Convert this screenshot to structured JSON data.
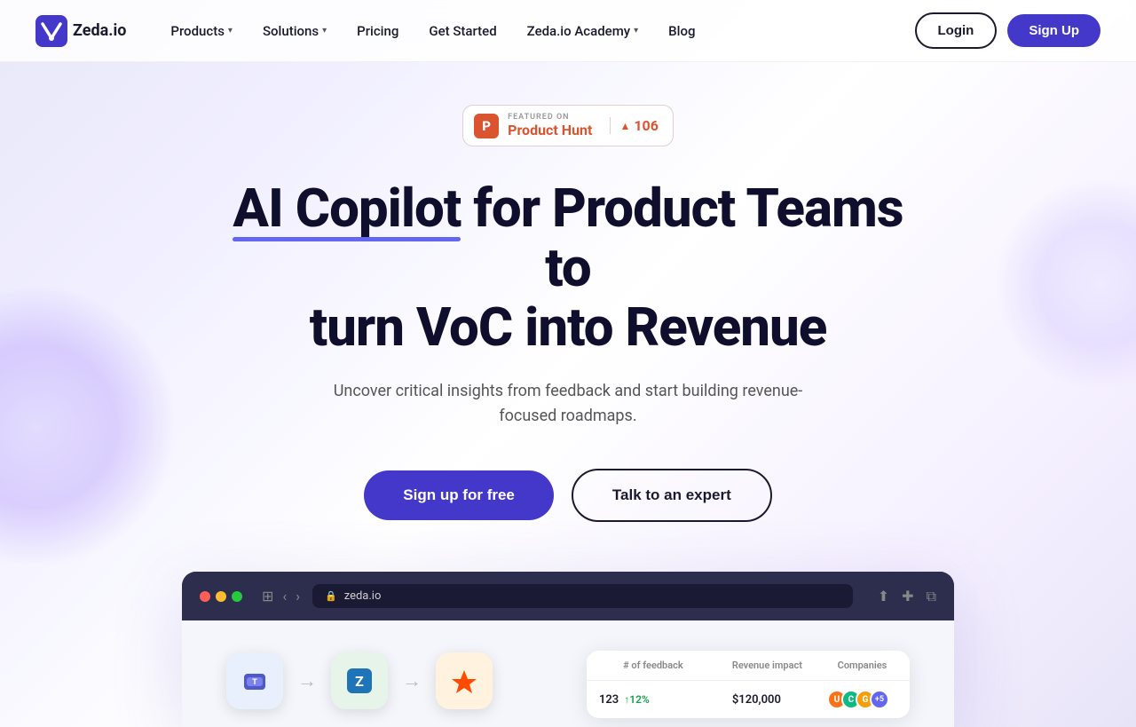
{
  "brand": {
    "name": "Zeda.io",
    "logo_text": "Zeda.io"
  },
  "nav": {
    "items": [
      {
        "label": "Products",
        "has_dropdown": true
      },
      {
        "label": "Solutions",
        "has_dropdown": true
      },
      {
        "label": "Pricing",
        "has_dropdown": false
      },
      {
        "label": "Get Started",
        "has_dropdown": false
      },
      {
        "label": "Zeda.io Academy",
        "has_dropdown": true
      },
      {
        "label": "Blog",
        "has_dropdown": false
      }
    ],
    "login_label": "Login",
    "signup_label": "Sign Up"
  },
  "product_hunt": {
    "featured_label": "FEATURED ON",
    "name": "Product Hunt",
    "score": "106"
  },
  "hero": {
    "title_line1": "AI Copilot for Product Teams to",
    "title_line2": "turn VoC into Revenue",
    "underline_word": "AI Copilot",
    "subtitle": "Uncover critical insights from feedback and start building revenue-focused roadmaps.",
    "cta_primary": "Sign up for free",
    "cta_secondary": "Talk to an expert"
  },
  "browser": {
    "address": "zeda.io"
  },
  "data_card": {
    "columns": [
      "# of feedback",
      "Revenue impact",
      "Companies"
    ],
    "rows": [
      {
        "feedback": "123",
        "feedback_change": "↑12%",
        "revenue": "$120,000",
        "companies_label": "+5"
      }
    ]
  },
  "integrations": [
    {
      "name": "microsoft-teams",
      "emoji": "🟦",
      "bg": "#e8f0fe"
    },
    {
      "name": "zendesk",
      "emoji": "🟩",
      "bg": "#e6f4ea"
    },
    {
      "name": "zapier",
      "emoji": "⚡",
      "bg": "#fff3e0"
    }
  ]
}
